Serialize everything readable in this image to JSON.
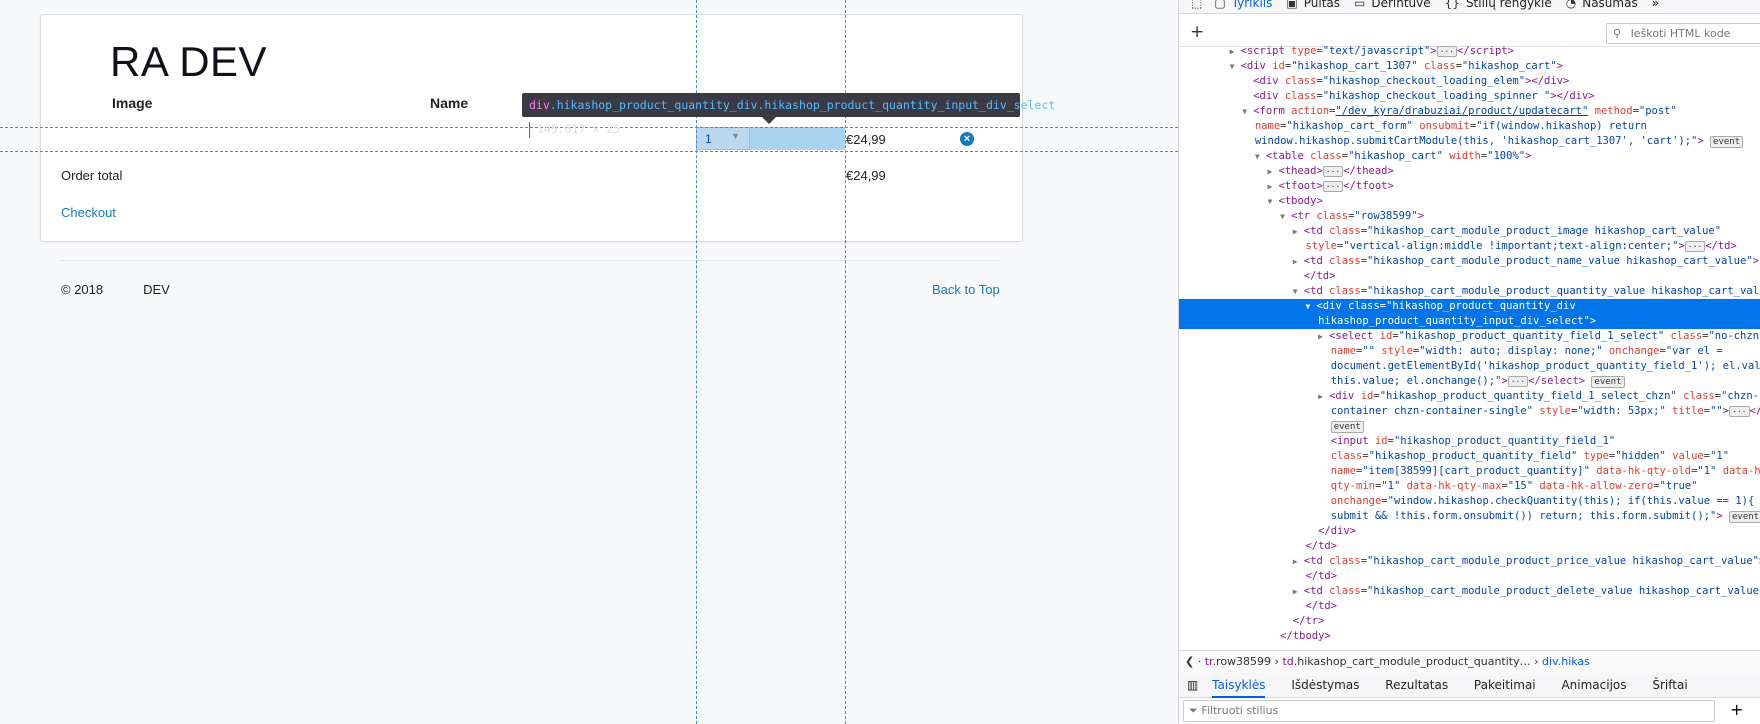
{
  "page": {
    "site_title": "RA DEV",
    "table": {
      "header_image": "Image",
      "header_name": "Name",
      "row": {
        "quantity": "1",
        "price": "€24,99"
      },
      "order_total_label": "Order total",
      "order_total_value": "€24,99",
      "checkout_link": "Checkout"
    },
    "footer": {
      "copyright": "© 2018",
      "copyright_suffix": "DEV",
      "back_to_top": "Back to Top"
    },
    "tooltip": {
      "tag": "div",
      "classes": ".hikashop_product_quantity_div.hikashop_product_quantity_input_div_select",
      "dimensions": "149.617 × 25"
    }
  },
  "devtools": {
    "tabs": [
      {
        "label": "Tyriklis",
        "icon": "inspector-icon",
        "active": true
      },
      {
        "label": "Pultas",
        "icon": "console-icon"
      },
      {
        "label": "Derintuvė",
        "icon": "debugger-icon"
      },
      {
        "label": "Stilių rengyklė",
        "icon": "style-editor-icon"
      },
      {
        "label": "Našumas",
        "icon": "performance-icon"
      }
    ],
    "more_tabs": "»",
    "search_placeholder": "Ieškoti HTML kode",
    "breadcrumbs": [
      {
        "tag": "tr",
        "cls": ".row38599"
      },
      {
        "tag": "td",
        "cls": ".hikashop_cart_module_product_quantity…"
      },
      {
        "tag": "div",
        "cls": ".hikas"
      }
    ],
    "bottom_tabs": [
      "Taisyklės",
      "Išdėstymas",
      "Rezultatas",
      "Pakeitimai",
      "Animacijos",
      "Šriftai"
    ],
    "filter_placeholder": "Filtruoti stilius",
    "badge_event": "event",
    "colors": {
      "selected_row": "#0074e8",
      "accent": "#0060df",
      "guide": "#3a8fd0"
    }
  }
}
